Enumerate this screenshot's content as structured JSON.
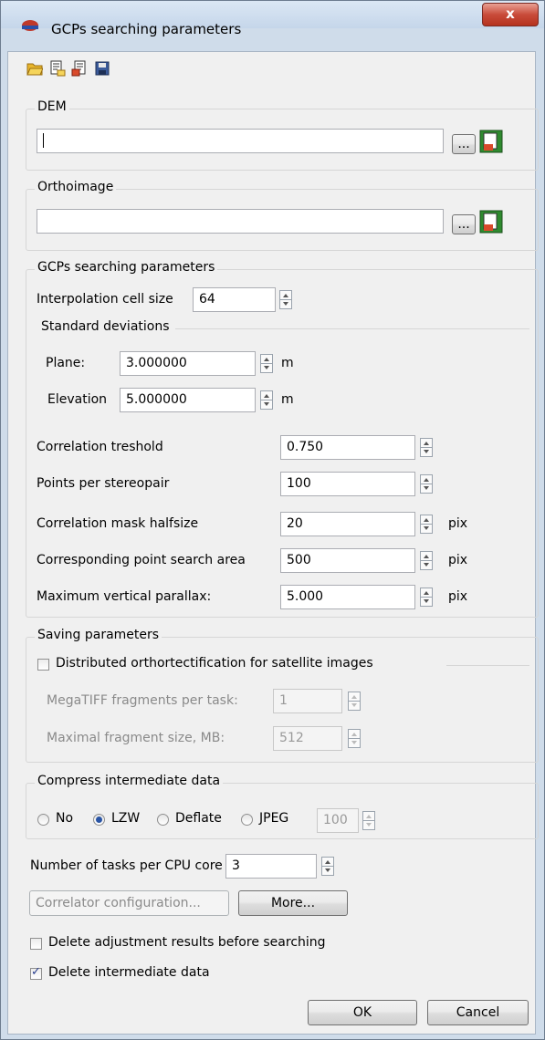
{
  "window": {
    "title": "GCPs searching parameters",
    "close_label": "x"
  },
  "icons": {
    "app": "dem-orthoimage-app-icon",
    "toolbar": [
      "open-folder-icon",
      "load-parameters-icon",
      "save-parameters-icon",
      "save-disk-icon"
    ]
  },
  "dem": {
    "legend": "DEM",
    "value": "",
    "browse_label": "..."
  },
  "orthoimage": {
    "legend": "Orthoimage",
    "value": "",
    "browse_label": "..."
  },
  "gcp": {
    "legend": "GCPs searching parameters",
    "interp_label": "Interpolation cell size",
    "interp_value": "64",
    "stddev_label": "Standard deviations",
    "plane_label": "Plane:",
    "plane_value": "3.000000",
    "plane_unit": "m",
    "elev_label": "Elevation",
    "elev_value": "5.000000",
    "elev_unit": "m",
    "corr_thresh_label": "Correlation treshold",
    "corr_thresh_value": "0.750",
    "points_label": "Points per stereopair",
    "points_value": "100",
    "mask_label": "Correlation mask halfsize",
    "mask_value": "20",
    "mask_unit": "pix",
    "search_label": "Corresponding point search area",
    "search_value": "500",
    "search_unit": "pix",
    "parallax_label": "Maximum vertical parallax:",
    "parallax_value": "5.000",
    "parallax_unit": "pix"
  },
  "saving": {
    "legend": "Saving parameters",
    "distributed_label": "Distributed orthortectification for satellite images",
    "distributed_checked": false,
    "fragments_label": "MegaTIFF fragments per task:",
    "fragments_value": "1",
    "maxsize_label": "Maximal fragment size, MB:",
    "maxsize_value": "512"
  },
  "compress": {
    "legend": "Compress intermediate data",
    "options": [
      "No",
      "LZW",
      "Deflate",
      "JPEG"
    ],
    "selected": "LZW",
    "jpeg_quality": "100"
  },
  "tasks_label": "Number of tasks per CPU core",
  "tasks_value": "3",
  "correlator_label": "Correlator configuration...",
  "more_label": "More...",
  "delete_adjust_label": "Delete adjustment results before searching",
  "delete_adjust_checked": false,
  "delete_inter_label": "Delete intermediate data",
  "delete_inter_checked": true,
  "ok_label": "OK",
  "cancel_label": "Cancel"
}
